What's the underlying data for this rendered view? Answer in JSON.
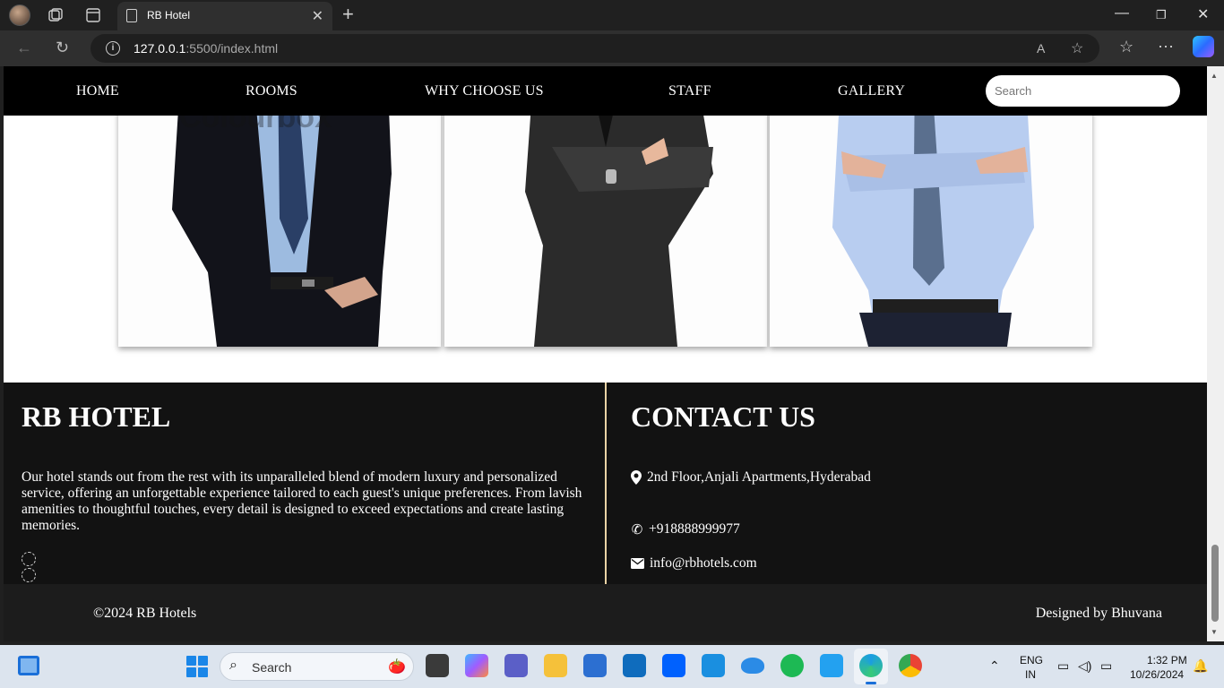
{
  "browser": {
    "tab_title": "RB Hotel",
    "url_host": "127.0.0.1",
    "url_path": ":5500/index.html"
  },
  "nav": {
    "links": [
      "HOME",
      "ROOMS",
      "WHY CHOOSE US",
      "STAFF",
      "GALLERY"
    ],
    "search_placeholder": "Search"
  },
  "staff": {
    "watermark": "Colourbox"
  },
  "footer": {
    "about_title": "RB HOTEL",
    "about_text": "Our hotel stands out from the rest with its unparalleled blend of modern luxury and personalized service, offering an unforgettable experience tailored to each guest's unique preferences. From lavish amenities to thoughtful touches, every detail is designed to exceed expectations and create lasting memories.",
    "contact_title": "CONTACT US",
    "address": "2nd Floor,Anjali Apartments,Hyderabad",
    "phone": "+918888999977",
    "email": "info@rbhotels.com",
    "copyright": "©2024 RB Hotels",
    "designer": "Designed by Bhuvana"
  },
  "taskbar": {
    "search_label": "Search",
    "lang_top": "ENG",
    "lang_bottom": "IN",
    "time": "1:32 PM",
    "date": "10/26/2024"
  },
  "colors": {
    "accent_divider": "#e9d3a5",
    "footer_bg": "#121212",
    "nav_bg": "#000000"
  }
}
